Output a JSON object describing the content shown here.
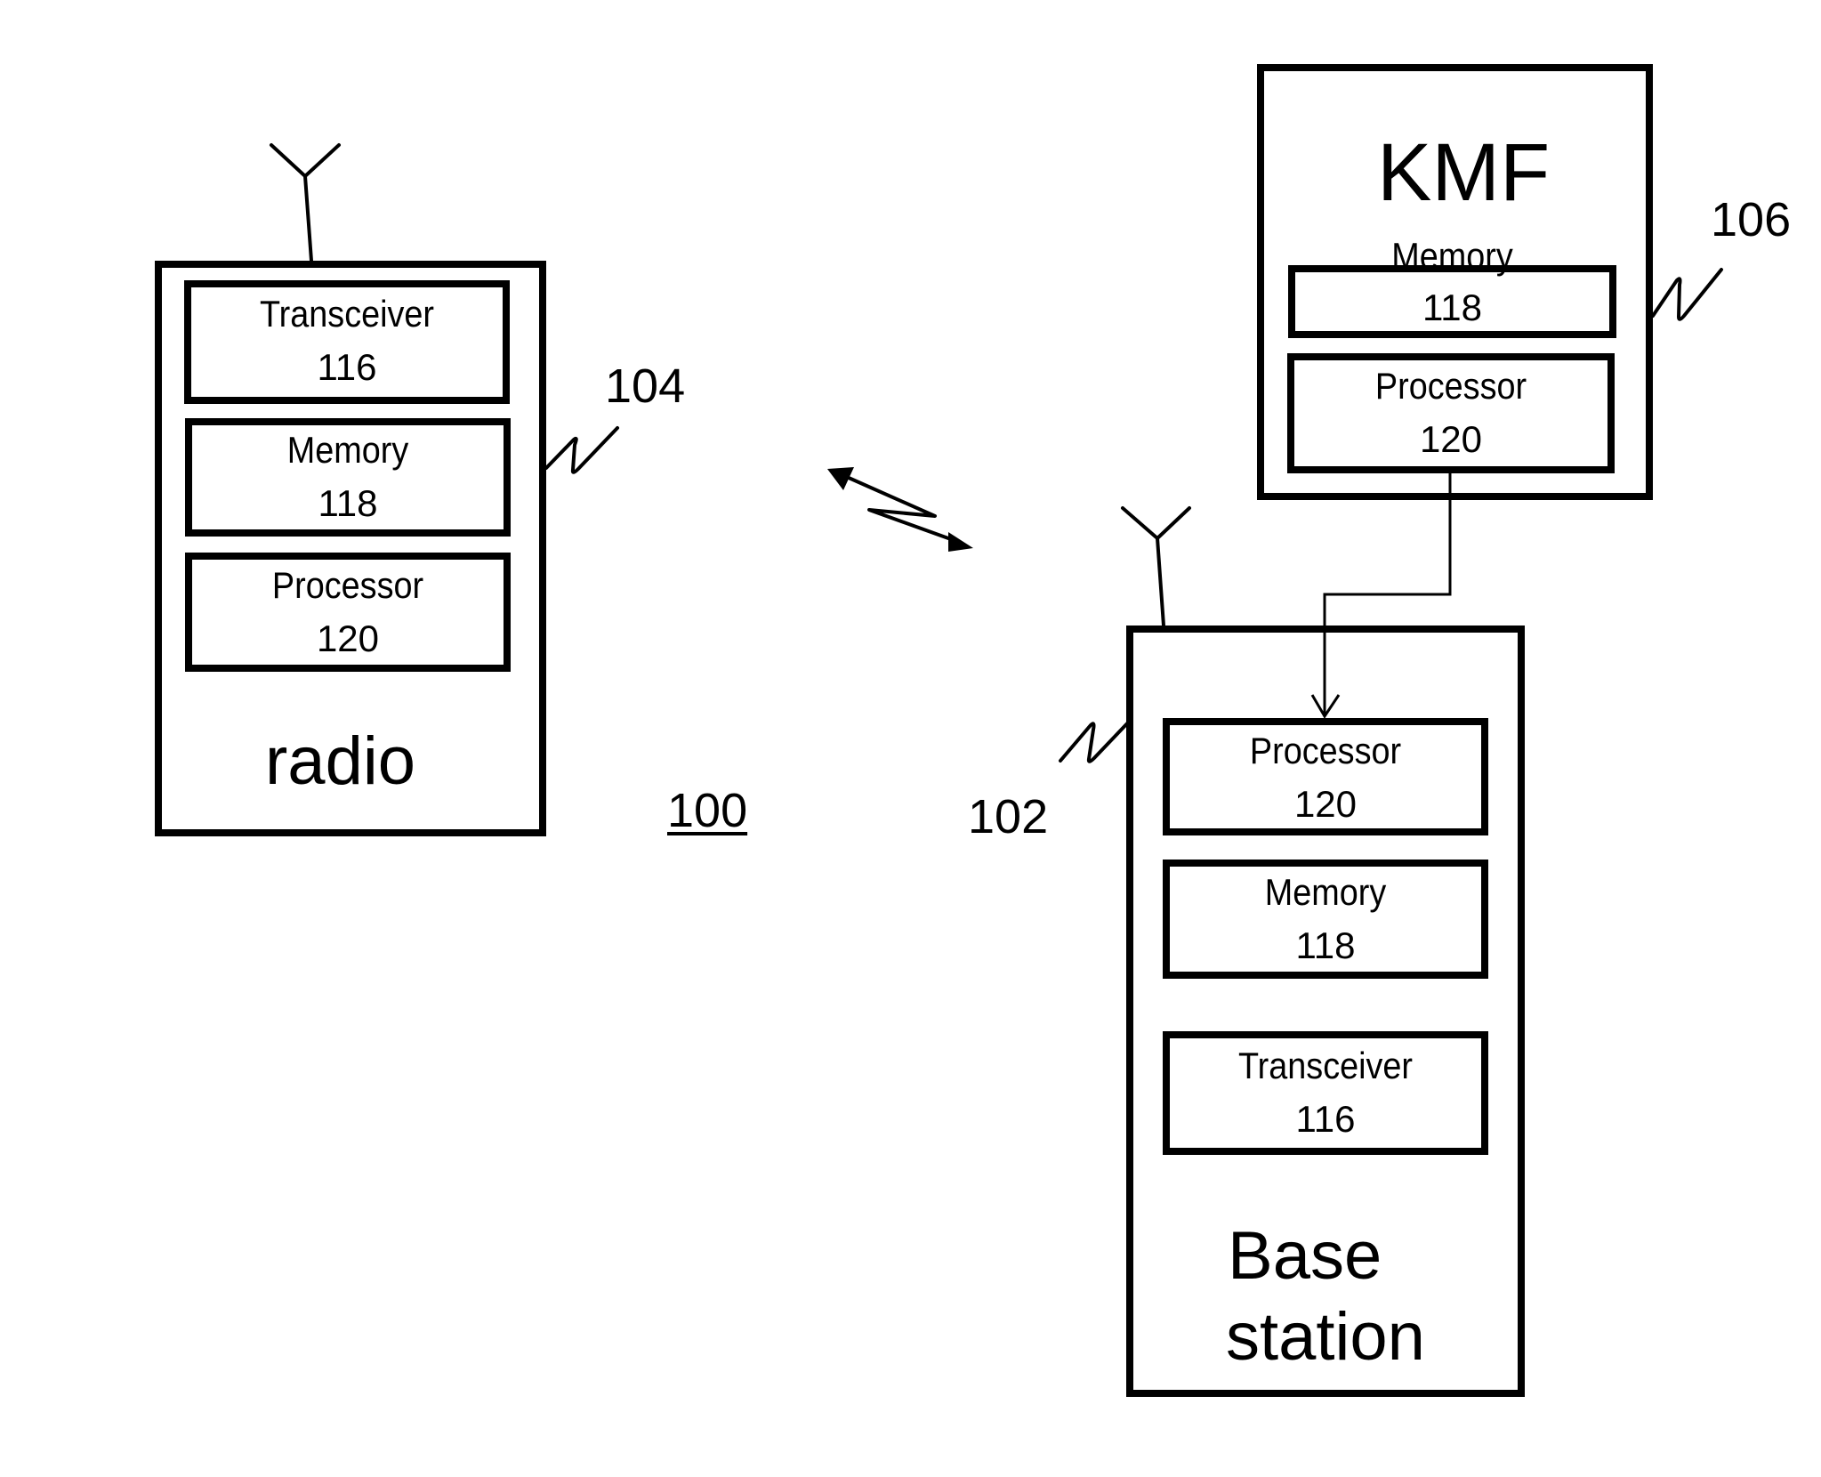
{
  "figure": {
    "system_ref": "100",
    "radio": {
      "title": "radio",
      "ref": "104",
      "components": [
        {
          "name": "Transceiver",
          "ref": "116"
        },
        {
          "name": "Memory",
          "ref": "118"
        },
        {
          "name": "Processor",
          "ref": "120"
        }
      ]
    },
    "kmf": {
      "title": "KMF",
      "ref": "106",
      "components": [
        {
          "name": "Memory",
          "ref": "118"
        },
        {
          "name": "Processor",
          "ref": "120"
        }
      ]
    },
    "base_station": {
      "title_line1": "Base",
      "title_line2": "station",
      "ref": "102",
      "components": [
        {
          "name": "Processor",
          "ref": "120"
        },
        {
          "name": "Memory",
          "ref": "118"
        },
        {
          "name": "Transceiver",
          "ref": "116"
        }
      ]
    },
    "stroke_color": "#000000",
    "background_color": "#ffffff"
  }
}
